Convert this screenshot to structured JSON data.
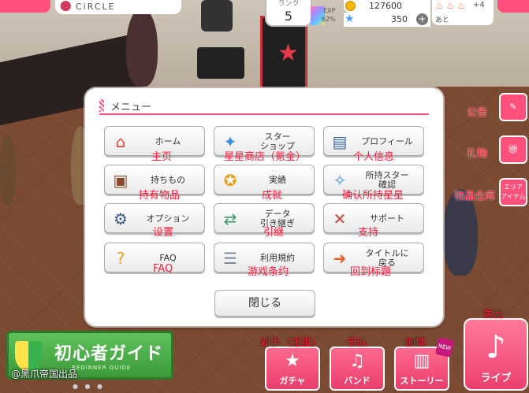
{
  "hud": {
    "location": "CiRCLE",
    "rank_label": "ランク",
    "rank_value": "5",
    "exp_label": "EXP",
    "exp_percent": "62%",
    "coins": "127600",
    "stars": "350",
    "flame_plus": "+4",
    "flame_next": "あと"
  },
  "side": {
    "notice_cn": "公告",
    "gift_cn": "礼物",
    "area_btn": "エリア\nアイテム",
    "area_cn": "物品仓库"
  },
  "dialog": {
    "title": "メニュー",
    "close": "閉じる",
    "buttons": [
      {
        "label": "ホーム",
        "cn": "主页"
      },
      {
        "label": "スター\nショップ",
        "cn": "星星商店（氪金）"
      },
      {
        "label": "プロフィール",
        "cn": "个人信息"
      },
      {
        "label": "持ちもの",
        "cn": "持有物品"
      },
      {
        "label": "実績",
        "cn": "成就"
      },
      {
        "label": "所持スター\n確認",
        "cn": "确认所持星星"
      },
      {
        "label": "オプション",
        "cn": "设置"
      },
      {
        "label": "データ\n引き継ぎ",
        "cn": "引继"
      },
      {
        "label": "サポート",
        "cn": "支持"
      },
      {
        "label": "FAQ",
        "cn": "FAQ"
      },
      {
        "label": "利用規約",
        "cn": "游戏条约"
      },
      {
        "label": "タイトルに\n戻る",
        "cn": "回到标题"
      }
    ]
  },
  "bottom": {
    "guide_title": "初心者ガイド",
    "guide_sub": "BEGINNER GUIDE",
    "gacha": "ガチャ",
    "gacha_cn": "剁手（扭蛋）",
    "band": "バンド",
    "band_cn": "乐队",
    "story": "ストーリー",
    "story_cn": "剧情",
    "live": "ライブ",
    "live_cn": "演出",
    "new_badge": "NEW",
    "watermark": "@黑爪帝国出品"
  },
  "colors": {
    "accent": "#ff4f7b",
    "annotation": "#ff1a3a"
  }
}
